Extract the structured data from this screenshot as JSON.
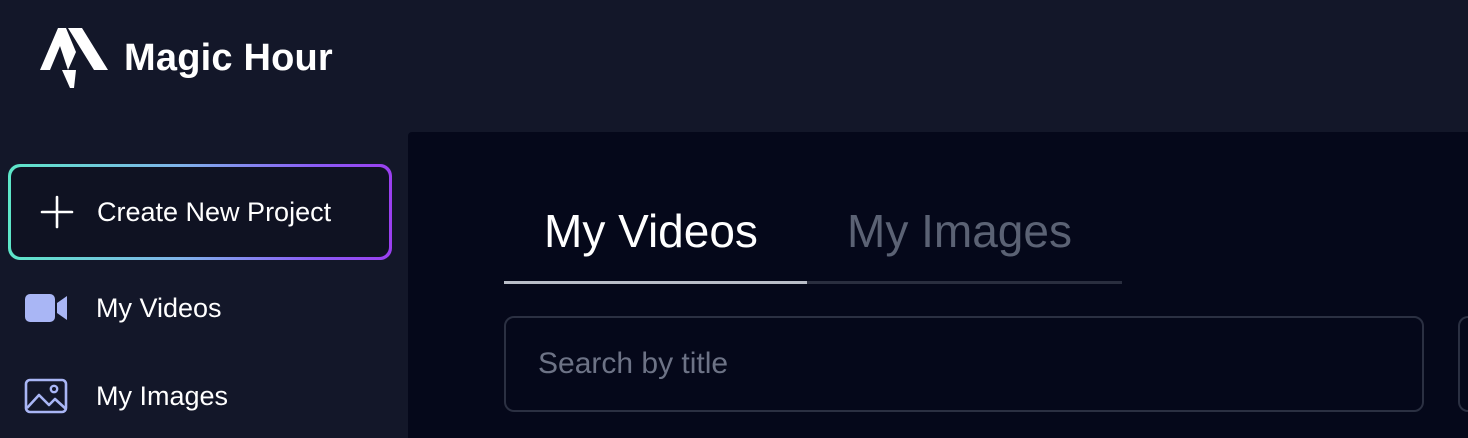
{
  "app": {
    "name": "Magic Hour",
    "logo_icon": "magic-hour-logo-icon"
  },
  "sidebar": {
    "create_button": {
      "label": "Create New Project",
      "icon": "plus-icon"
    },
    "items": [
      {
        "label": "My Videos",
        "icon": "video-camera-icon",
        "icon_color": "#a9b6f5"
      },
      {
        "label": "My Images",
        "icon": "image-icon",
        "icon_color": "#a9b6f5"
      }
    ]
  },
  "main": {
    "tabs": [
      {
        "label": "My Videos",
        "active": true
      },
      {
        "label": "My Images",
        "active": false
      }
    ],
    "search": {
      "placeholder": "Search by title",
      "value": ""
    }
  },
  "colors": {
    "background": "#131729",
    "main_background": "#05081a",
    "gradient_start": "#5de6c8",
    "gradient_end": "#9a3ff0",
    "inactive_tab": "#5b6274",
    "icon_accent": "#a9b6f5"
  }
}
